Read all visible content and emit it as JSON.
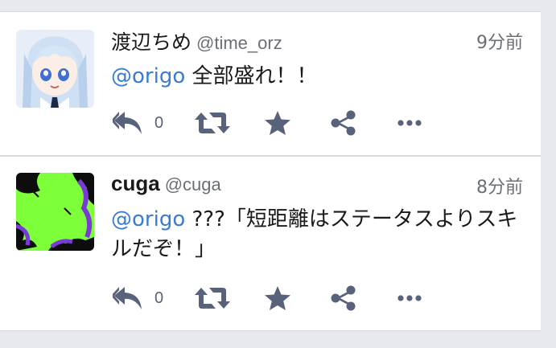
{
  "tweets": [
    {
      "display_name": "渡辺ちめ",
      "screen_name": "@time_orz",
      "time_ago": "9分前",
      "mention": "@origo",
      "text": " 全部盛れ！！",
      "reply_count": "0",
      "avatar_icon": "anime-avatar-icon"
    },
    {
      "display_name": "cuga",
      "screen_name": "@cuga",
      "time_ago": "8分前",
      "mention": "@origo",
      "text": " ???「短距離はステータスよりスキルだぞ！」",
      "reply_count": "0",
      "avatar_icon": "green-black-avatar-icon"
    }
  ],
  "colors": {
    "mention": "#3a7bd5",
    "action_icon": "#58627a",
    "background": "#e6e9ee"
  }
}
